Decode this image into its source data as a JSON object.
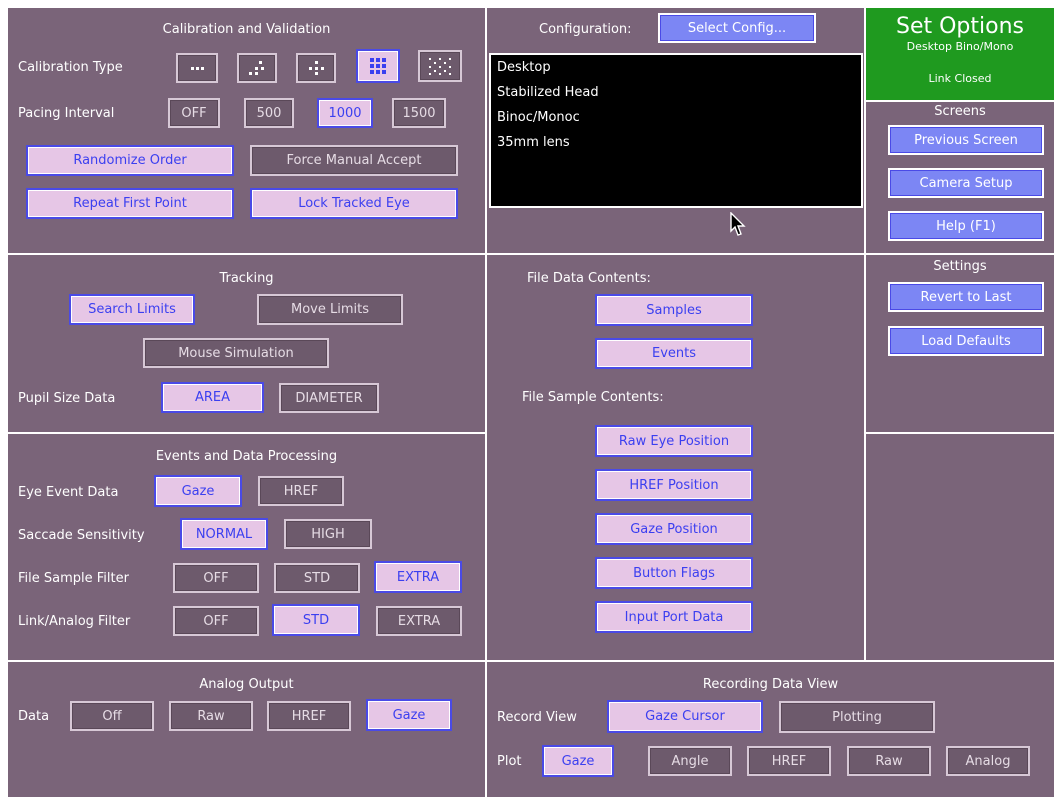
{
  "calibration": {
    "title": "Calibration and Validation",
    "calibration_type_label": "Calibration Type",
    "pacing_interval_label": "Pacing Interval",
    "pacing_options": [
      "OFF",
      "500",
      "1000",
      "1500"
    ],
    "randomize_order": "Randomize Order",
    "force_manual_accept": "Force Manual Accept",
    "repeat_first_point": "Repeat First Point",
    "lock_tracked_eye": "Lock Tracked Eye"
  },
  "configuration": {
    "label": "Configuration:",
    "select_button": "Select  Config...",
    "items": [
      "Desktop",
      "Stabilized Head",
      "Binoc/Monoc",
      "35mm lens"
    ]
  },
  "header": {
    "title": "Set Options",
    "subtitle": "Desktop Bino/Mono",
    "link_status": "Link Closed"
  },
  "screens": {
    "title": "Screens",
    "previous_screen": "Previous Screen",
    "camera_setup": "Camera Setup",
    "help": "Help (F1)"
  },
  "settings": {
    "title": "Settings",
    "revert": "Revert to Last",
    "load_defaults": "Load Defaults"
  },
  "tracking": {
    "title": "Tracking",
    "search_limits": "Search Limits",
    "move_limits": "Move Limits",
    "mouse_simulation": "Mouse Simulation",
    "pupil_label": "Pupil Size Data",
    "area": "AREA",
    "diameter": "DIAMETER"
  },
  "file_data": {
    "title": "File Data Contents:",
    "samples": "Samples",
    "events": "Events",
    "sample_title": "File Sample Contents:",
    "raw_eye": "Raw Eye Position",
    "href_pos": "HREF Position",
    "gaze_pos": "Gaze Position",
    "button_flags": "Button Flags",
    "input_port": "Input Port Data"
  },
  "events": {
    "title": "Events and Data Processing",
    "eye_event_label": "Eye Event Data",
    "gaze": "Gaze",
    "href": "HREF",
    "saccade_label": "Saccade Sensitivity",
    "normal": "NORMAL",
    "high": "HIGH",
    "file_filter_label": "File Sample Filter",
    "link_filter_label": "Link/Analog Filter",
    "filter_off": "OFF",
    "filter_std": "STD",
    "filter_extra": "EXTRA"
  },
  "analog": {
    "title": "Analog Output",
    "data_label": "Data",
    "off": "Off",
    "raw": "Raw",
    "href": "HREF",
    "gaze": "Gaze"
  },
  "recording": {
    "title": "Recording Data View",
    "record_view_label": "Record View",
    "gaze_cursor": "Gaze Cursor",
    "plotting": "Plotting",
    "plot_label": "Plot",
    "plot_gaze": "Gaze",
    "plot_angle": "Angle",
    "plot_href": "HREF",
    "plot_raw": "Raw",
    "plot_analog": "Analog"
  },
  "colors": {
    "panel": "#7a6479",
    "header_green": "#1f9a1f",
    "selected_fill": "#e6c6e6",
    "selected_text": "#3b3ff0",
    "action_blue": "#7c86f4"
  },
  "icons": [
    "mouse-pointer-icon"
  ]
}
